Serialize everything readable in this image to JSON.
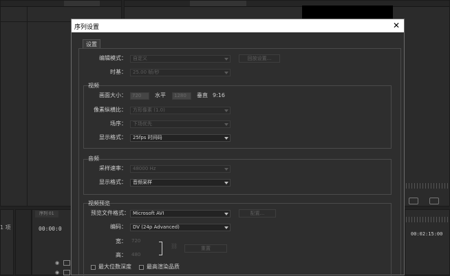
{
  "background": {
    "left_tab": "序列 01",
    "timecode_left": "00:00:0",
    "timecode_right": "00:02:15:00",
    "items_count": "1 项"
  },
  "dialog": {
    "title": "序列设置",
    "tab": "设置",
    "edit_mode": {
      "label": "编辑模式：",
      "value": "自定义"
    },
    "playback_settings_btn": "回放设置...",
    "timebase": {
      "label": "时基：",
      "value": "25.00 帧/秒"
    },
    "video": {
      "title": "视频",
      "frame_size": {
        "label": "画面大小：",
        "width": "720",
        "horizontal": "水平",
        "height": "1280",
        "vertical": "垂直",
        "ratio": "9:16"
      },
      "pixel_aspect": {
        "label": "像素纵横比：",
        "value": "方形像素 (1.0)"
      },
      "field": {
        "label": "场序：",
        "value": "下场优先"
      },
      "display_format": {
        "label": "显示格式：",
        "value": "25fps 时间码"
      }
    },
    "audio": {
      "title": "音频",
      "sample_rate": {
        "label": "采样速率：",
        "value": "48000 Hz"
      },
      "display_format": {
        "label": "显示格式：",
        "value": "音频采样"
      }
    },
    "preview": {
      "title": "视频预览",
      "file_format": {
        "label": "预览文件格式：",
        "value": "Microsoft AVI"
      },
      "config_btn": "配置...",
      "codec": {
        "label": "编码：",
        "value": "DV (24p Advanced)"
      },
      "width": {
        "label": "宽：",
        "value": "720"
      },
      "height": {
        "label": "高：",
        "value": "480"
      },
      "reset_btn": "重置",
      "max_bit_depth": "最大位数深度",
      "max_render_quality": "最高渲染品质"
    }
  }
}
